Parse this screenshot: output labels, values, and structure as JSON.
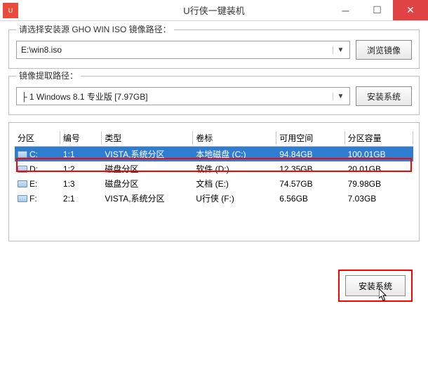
{
  "titlebar": {
    "title": "U行侠一键装机"
  },
  "source": {
    "legend": "请选择安装源 GHO WIN ISO 镜像路径：",
    "value": "E:\\win8.iso",
    "browse_label": "浏览镜像"
  },
  "extract": {
    "legend": "镜像提取路径：",
    "value": "├ 1 Windows 8.1 专业版 [7.97GB]",
    "install_label": "安装系统"
  },
  "table": {
    "headers": {
      "drive": "分区",
      "num": "编号",
      "type": "类型",
      "label": "卷标",
      "free": "可用空间",
      "cap": "分区容量"
    },
    "rows": [
      {
        "drive": "C:",
        "num": "1:1",
        "type": "VISTA,系统分区",
        "label": "本地磁盘 (C:)",
        "free": "94.84GB",
        "cap": "100.01GB",
        "selected": true
      },
      {
        "drive": "D:",
        "num": "1:2",
        "type": "磁盘分区",
        "label": "软件 (D:)",
        "free": "12.35GB",
        "cap": "20.01GB",
        "selected": false
      },
      {
        "drive": "E:",
        "num": "1:3",
        "type": "磁盘分区",
        "label": "文档 (E:)",
        "free": "74.57GB",
        "cap": "79.98GB",
        "selected": false
      },
      {
        "drive": "F:",
        "num": "2:1",
        "type": "VISTA,系统分区",
        "label": "U行侠 (F:)",
        "free": "6.56GB",
        "cap": "7.03GB",
        "selected": false
      }
    ]
  },
  "bottom": {
    "install_label": "安装系统"
  }
}
